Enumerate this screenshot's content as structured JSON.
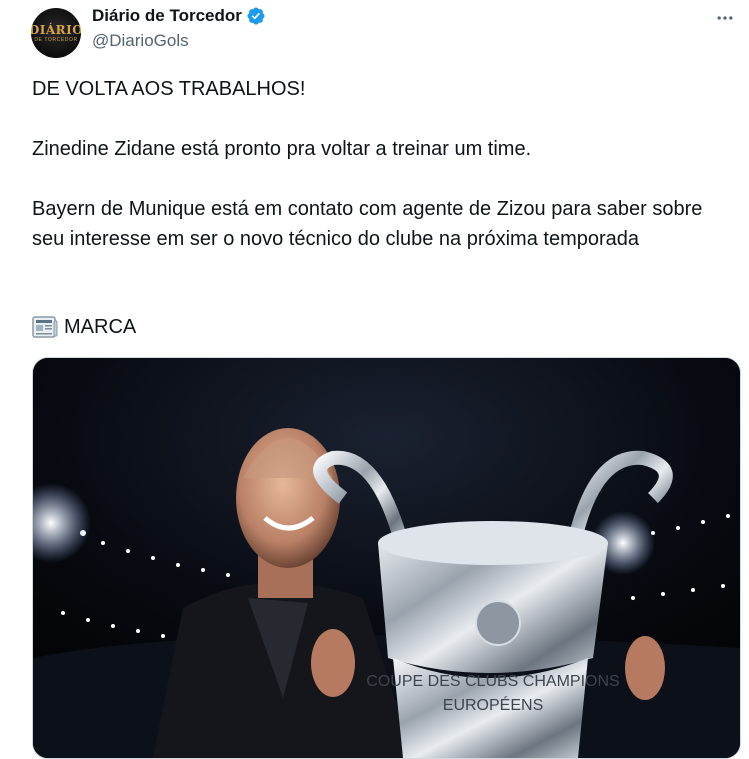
{
  "account": {
    "display_name": "Diário de Torcedor",
    "handle": "@DiarioGols",
    "verified": true,
    "avatar_text": "DIÁRIO",
    "avatar_subtext": "DE TORCEDOR"
  },
  "tweet": {
    "line1": "DE VOLTA AOS TRABALHOS!",
    "line2": "Zinedine Zidane está pronto pra voltar a treinar um time.",
    "line3": "Bayern de Munique está em contato com agente de Zizou para saber sobre seu interesse em ser o novo técnico do clube na próxima temporada",
    "source_label": "MARCA",
    "source_icon": "newspaper-icon"
  },
  "media": {
    "trophy_inscription_1": "COUPE DES CLUBS CHAMPIONS",
    "trophy_inscription_2": "EUROPÉENS"
  },
  "colors": {
    "verified_blue": "#1d9bf0",
    "secondary_text": "#536471",
    "primary_text": "#0f1419"
  }
}
